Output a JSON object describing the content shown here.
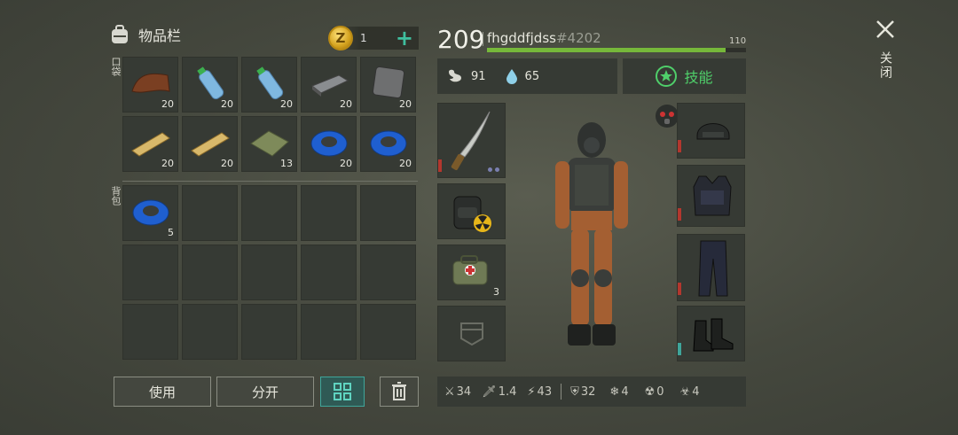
{
  "inventory": {
    "title": "物品栏",
    "coin_count": "1",
    "pocket_label": "口袋",
    "backpack_label": "背包",
    "pocket_slots": [
      {
        "item": "leather",
        "count": "20"
      },
      {
        "item": "water-bottle",
        "count": "20"
      },
      {
        "item": "water-bottle",
        "count": "20"
      },
      {
        "item": "iron-bar",
        "count": "20"
      },
      {
        "item": "metal-plate",
        "count": "20"
      },
      {
        "item": "wood-plank",
        "count": "20"
      },
      {
        "item": "wood-plank",
        "count": "20"
      },
      {
        "item": "cloth",
        "count": "13"
      },
      {
        "item": "duct-tape",
        "count": "20"
      },
      {
        "item": "duct-tape",
        "count": "20"
      }
    ],
    "backpack_slots": [
      {
        "item": "duct-tape",
        "count": "5"
      }
    ],
    "buttons": {
      "use": "使用",
      "split": "分开"
    }
  },
  "character": {
    "level": "209",
    "name": "fhgddfjdss",
    "tag": "#4202",
    "xp_max": "110",
    "xp_fraction": 0.92,
    "hunger": "91",
    "thirst": "65",
    "skill_label": "技能",
    "backpack_equipment_count": "3"
  },
  "stats": {
    "attack": "34",
    "attack_speed": "1.4",
    "move_speed": "43",
    "armor": "32",
    "cold_resist": "4",
    "radiation_resist": "0",
    "poison_resist": "4"
  },
  "window": {
    "close_label": "关闭"
  },
  "colors": {
    "accent_green": "#76b83a",
    "plus_teal": "#3fbf9f",
    "durability_red": "#b3372e"
  }
}
